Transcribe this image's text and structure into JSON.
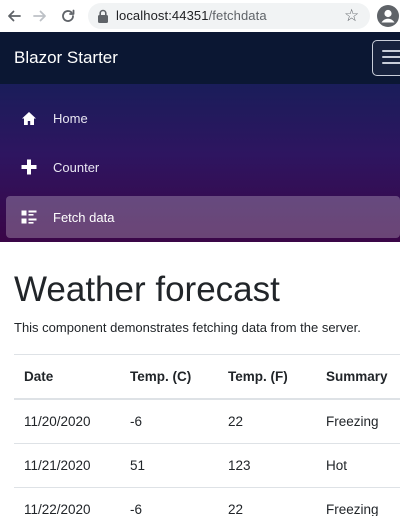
{
  "browser": {
    "url_host": "localhost:44351",
    "url_path": "/fetchdata",
    "back_icon": "back-arrow-icon",
    "forward_icon": "forward-arrow-icon",
    "reload_icon": "reload-icon",
    "lock_icon": "lock-icon",
    "bookmark_icon": "star-icon",
    "profile_icon": "account-icon"
  },
  "app": {
    "brand": "Blazor Starter",
    "menu_icon": "hamburger-icon"
  },
  "nav": {
    "items": [
      {
        "label": "Home",
        "icon": "home-icon",
        "active": false
      },
      {
        "label": "Counter",
        "icon": "plus-icon",
        "active": false
      },
      {
        "label": "Fetch data",
        "icon": "list-rich-icon",
        "active": true
      }
    ]
  },
  "main": {
    "title": "Weather forecast",
    "description": "This component demonstrates fetching data from the server.",
    "table": {
      "headers": [
        "Date",
        "Temp. (C)",
        "Temp. (F)",
        "Summary"
      ],
      "rows": [
        [
          "11/20/2020",
          "-6",
          "22",
          "Freezing"
        ],
        [
          "11/21/2020",
          "51",
          "123",
          "Hot"
        ],
        [
          "11/22/2020",
          "-6",
          "22",
          "Freezing"
        ]
      ]
    }
  },
  "colors": {
    "topbar": "#0b1733",
    "sidebar_top": "#1a1d5a",
    "sidebar_bottom": "#3a0647",
    "active_nav_bg": "rgba(255,255,255,0.25)"
  }
}
